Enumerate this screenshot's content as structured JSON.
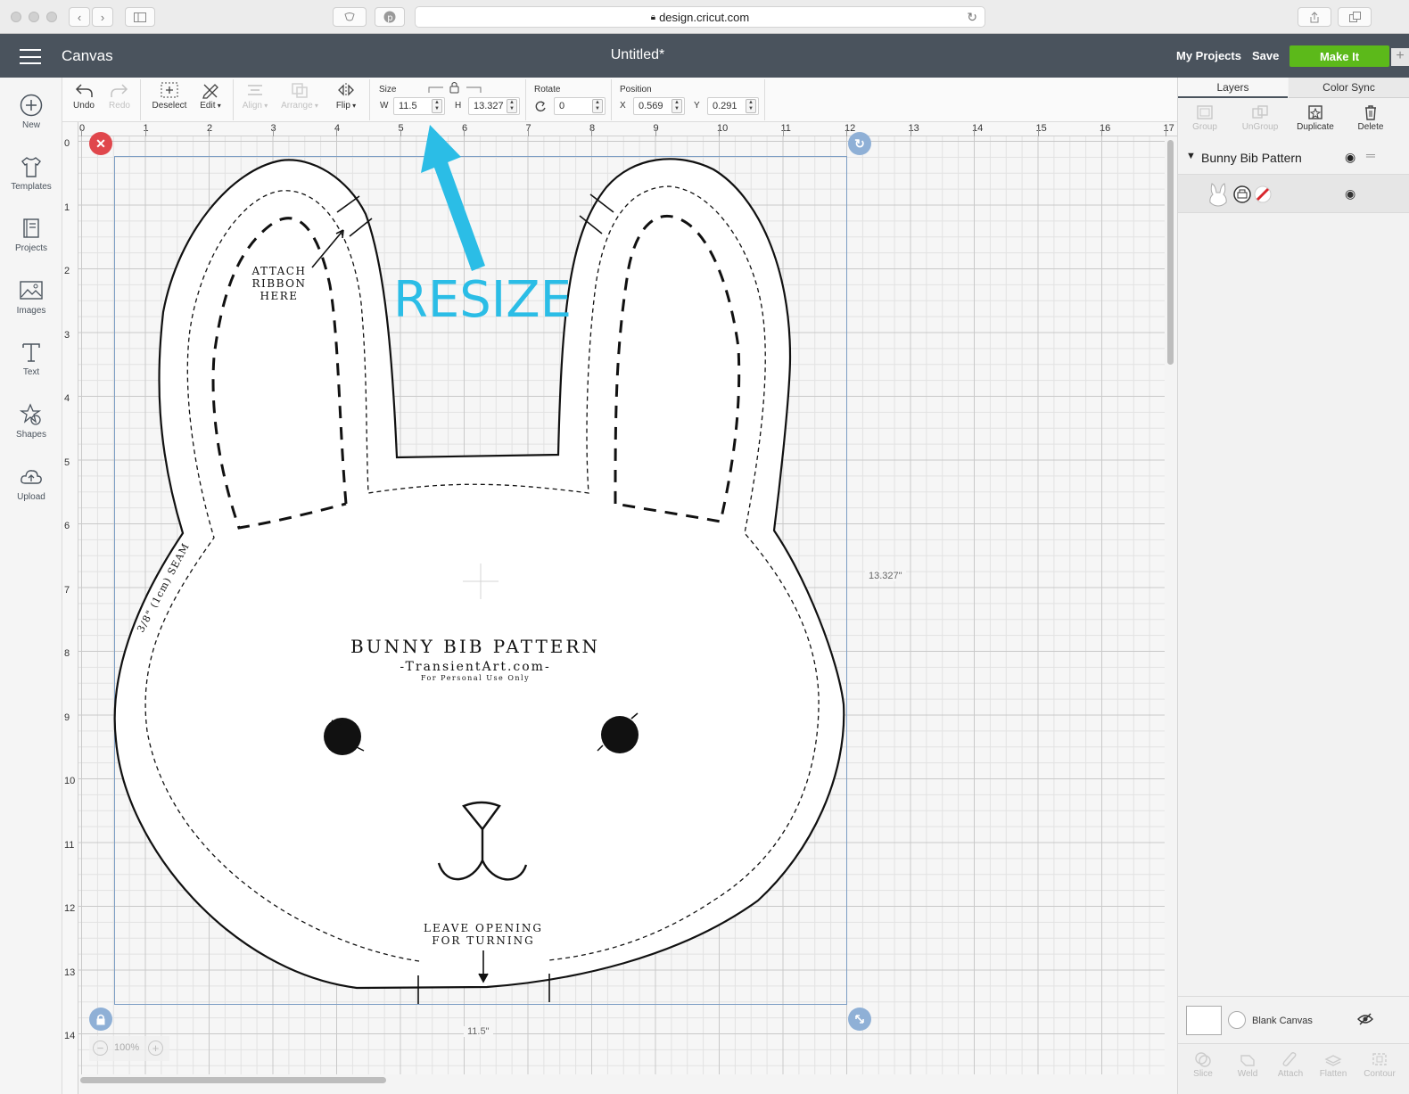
{
  "browser": {
    "url": "design.cricut.com",
    "secure_icon": "lock-icon"
  },
  "header": {
    "menu_icon": "hamburger-icon",
    "app_name": "Canvas",
    "document_title": "Untitled*",
    "my_projects_label": "My Projects",
    "save_label": "Save",
    "make_it_label": "Make It",
    "make_it_color": "#5cb91a",
    "header_color": "#4a535d"
  },
  "sidebar": {
    "items": [
      {
        "label": "New",
        "icon": "plus-circle-icon"
      },
      {
        "label": "Templates",
        "icon": "tshirt-icon"
      },
      {
        "label": "Projects",
        "icon": "book-icon"
      },
      {
        "label": "Images",
        "icon": "image-icon"
      },
      {
        "label": "Text",
        "icon": "text-icon"
      },
      {
        "label": "Shapes",
        "icon": "shapes-icon"
      },
      {
        "label": "Upload",
        "icon": "cloud-upload-icon"
      }
    ]
  },
  "toolbar": {
    "undo_label": "Undo",
    "redo_label": "Redo",
    "deselect_label": "Deselect",
    "edit_label": "Edit",
    "align_label": "Align",
    "arrange_label": "Arrange",
    "flip_label": "Flip",
    "size_label": "Size",
    "w_label": "W",
    "w_value": "11.5",
    "h_label": "H",
    "h_value": "13.327",
    "rotate_label": "Rotate",
    "rotate_value": "0",
    "position_label": "Position",
    "x_label": "X",
    "x_value": "0.569",
    "y_label": "Y",
    "y_value": "0.291"
  },
  "canvas": {
    "ruler_top": [
      "0",
      "1",
      "2",
      "3",
      "4",
      "5",
      "6",
      "7",
      "8",
      "9",
      "10",
      "11",
      "12",
      "13",
      "14",
      "15",
      "16",
      "17"
    ],
    "ruler_left": [
      "0",
      "1",
      "2",
      "3",
      "4",
      "5",
      "6",
      "7",
      "8",
      "9",
      "10",
      "11",
      "12",
      "13",
      "14"
    ],
    "height_dimension": "13.327\"",
    "width_dimension": "11.5\"",
    "zoom_level": "100%",
    "selection_color": "#7d9ec4",
    "delete_handle_color": "#e0474c",
    "handle_color": "#8fb0d6"
  },
  "artwork": {
    "pattern_title": "BUNNY BIB PATTERN",
    "site": "-TransientArt.com-",
    "usage": "For Personal Use Only",
    "ribbon_note": [
      "ATTACH",
      "RIBBON",
      "HERE"
    ],
    "opening_note": [
      "LEAVE OPENING",
      "FOR TURNING"
    ],
    "seam_note": "3/8\" (1cm) SEAM",
    "resize_callout": "RESIZE",
    "callout_color": "#2bbde6"
  },
  "layers_panel": {
    "tabs": [
      "Layers",
      "Color Sync"
    ],
    "actions": [
      {
        "label": "Group",
        "enabled": false
      },
      {
        "label": "UnGroup",
        "enabled": false
      },
      {
        "label": "Duplicate",
        "enabled": true
      },
      {
        "label": "Delete",
        "enabled": true
      }
    ],
    "group_name": "Bunny Bib Pattern",
    "blank_canvas_label": "Blank Canvas",
    "bottom_tools": [
      "Slice",
      "Weld",
      "Attach",
      "Flatten",
      "Contour"
    ]
  }
}
